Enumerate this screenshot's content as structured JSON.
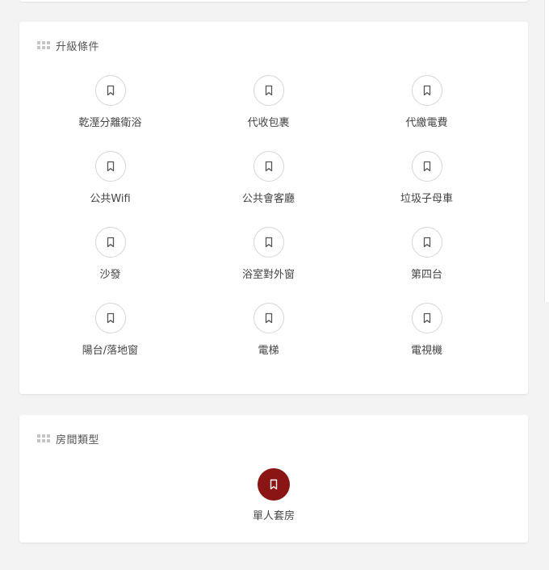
{
  "upgrade": {
    "title": "升級條件",
    "items": [
      {
        "label": "乾溼分離衛浴",
        "icon": "bookmark-icon"
      },
      {
        "label": "代收包裹",
        "icon": "bookmark-icon"
      },
      {
        "label": "代繳電費",
        "icon": "bookmark-icon"
      },
      {
        "label": "公共Wifi",
        "icon": "bookmark-icon"
      },
      {
        "label": "公共會客廳",
        "icon": "bookmark-icon"
      },
      {
        "label": "垃圾子母車",
        "icon": "bookmark-icon"
      },
      {
        "label": "沙發",
        "icon": "bookmark-icon"
      },
      {
        "label": "浴室對外窗",
        "icon": "bookmark-icon"
      },
      {
        "label": "第四台",
        "icon": "bookmark-icon"
      },
      {
        "label": "陽台/落地窗",
        "icon": "bookmark-icon"
      },
      {
        "label": "電梯",
        "icon": "bookmark-icon"
      },
      {
        "label": "電視機",
        "icon": "bookmark-icon"
      }
    ]
  },
  "room_type": {
    "title": "房間類型",
    "items": [
      {
        "label": "單人套房",
        "icon": "bookmark-icon",
        "selected": true
      }
    ]
  },
  "colors": {
    "accent": "#8b1414",
    "icon_stroke": "#555555",
    "background": "#f3f3f3",
    "card": "#ffffff"
  }
}
